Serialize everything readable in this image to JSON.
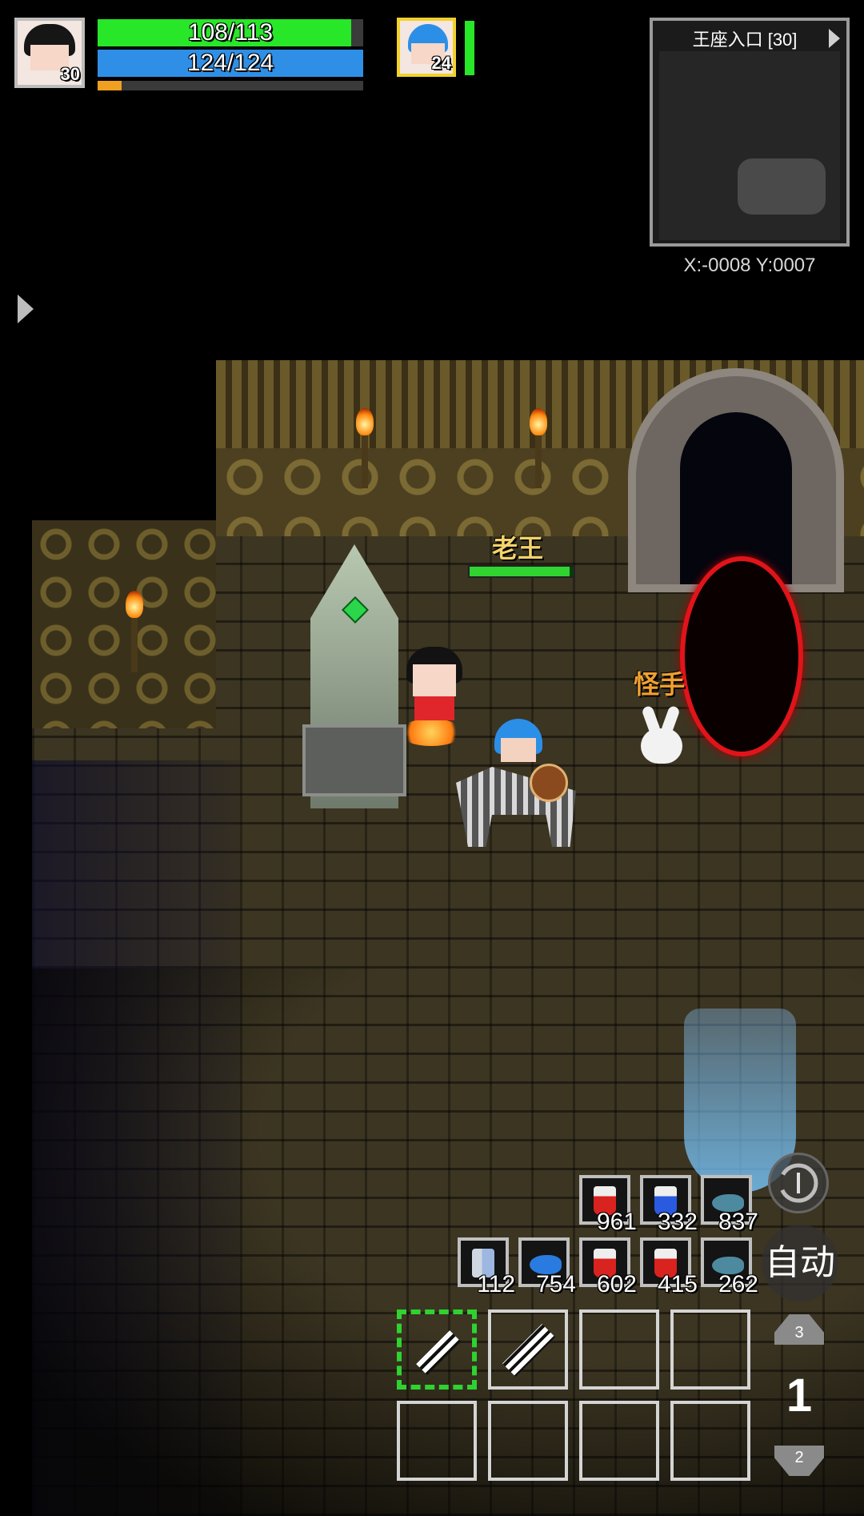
{
  "player": {
    "level": "30",
    "hp_text": "108/113",
    "hp_fraction": 0.956,
    "mp_text": "124/124",
    "mp_fraction": 1.0,
    "exp_fraction": 0.09
  },
  "companion": {
    "level": "24",
    "hp_fraction": 1.0
  },
  "minimap": {
    "location": "王座入口 [30]",
    "coords": "X:-0008  Y:0007"
  },
  "world": {
    "npc_name": "老王",
    "npc_hp_fraction": 0.96,
    "monster_name": "怪手"
  },
  "quick_items_row1": [
    {
      "icon": "red-potion-icon",
      "count": "961"
    },
    {
      "icon": "blue-potion-icon",
      "count": "332"
    },
    {
      "icon": "fish-icon",
      "count": "837"
    }
  ],
  "quick_items_row2": [
    {
      "icon": "scroll-icon",
      "count": "112"
    },
    {
      "icon": "blue-fish-icon",
      "count": "754"
    },
    {
      "icon": "red-potion-icon",
      "count": "602"
    },
    {
      "icon": "red-potion-icon",
      "count": "415"
    },
    {
      "icon": "fish-icon",
      "count": "262"
    }
  ],
  "skills": {
    "slot1_icon": "slash-skill-icon",
    "slot2_icon": "multi-slash-skill-icon"
  },
  "controls": {
    "auto_label": "自动",
    "page_up": "3",
    "page_current": "1",
    "page_down": "2"
  },
  "colors": {
    "hp": "#28e628",
    "mp": "#2f8fe6",
    "exp": "#f0a020",
    "skill_active": "#2fd22f",
    "npc_name": "#f3d36a",
    "monster_name": "#f0a030",
    "portal_ring": "#e0141a"
  }
}
